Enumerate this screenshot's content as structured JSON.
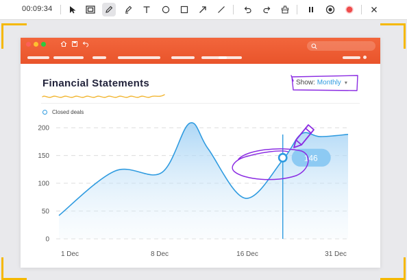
{
  "recorder": {
    "timer": "00:09:34",
    "tools": [
      "select-tool",
      "screenshot-tool",
      "pen-tool",
      "highlighter-tool",
      "text-tool",
      "ellipse-tool",
      "rectangle-tool",
      "arrow-tool",
      "line-tool",
      "undo",
      "redo",
      "clear-annotations",
      "pause",
      "stop-recording",
      "record",
      "close"
    ],
    "active_tool": "pen-tool",
    "frame_color": "#f5b800"
  },
  "app": {
    "brand_color": "#ef5a30",
    "accent_color": "#2f9be0",
    "annotation_color": "#8a2be2"
  },
  "dashboard": {
    "title": "Financial Statements",
    "show_label": "Show:",
    "show_value": "Monthly"
  },
  "chart_data": {
    "type": "area",
    "legend": [
      "Closed deals"
    ],
    "x_tick_labels": [
      "1 Dec",
      "8 Dec",
      "16 Dec",
      "31 Dec"
    ],
    "y_ticks": [
      0,
      50,
      100,
      150,
      200
    ],
    "ylim": [
      0,
      210
    ],
    "grid": true,
    "series": [
      {
        "name": "Closed deals",
        "points": [
          [
            0,
            42
          ],
          [
            6,
            122
          ],
          [
            11,
            119
          ],
          [
            14,
            208
          ],
          [
            16,
            162
          ],
          [
            20,
            73
          ],
          [
            24,
            142
          ],
          [
            26,
            189
          ],
          [
            28,
            184
          ],
          [
            31,
            188
          ]
        ]
      }
    ],
    "highlight": {
      "x": 24,
      "value": "146"
    }
  }
}
